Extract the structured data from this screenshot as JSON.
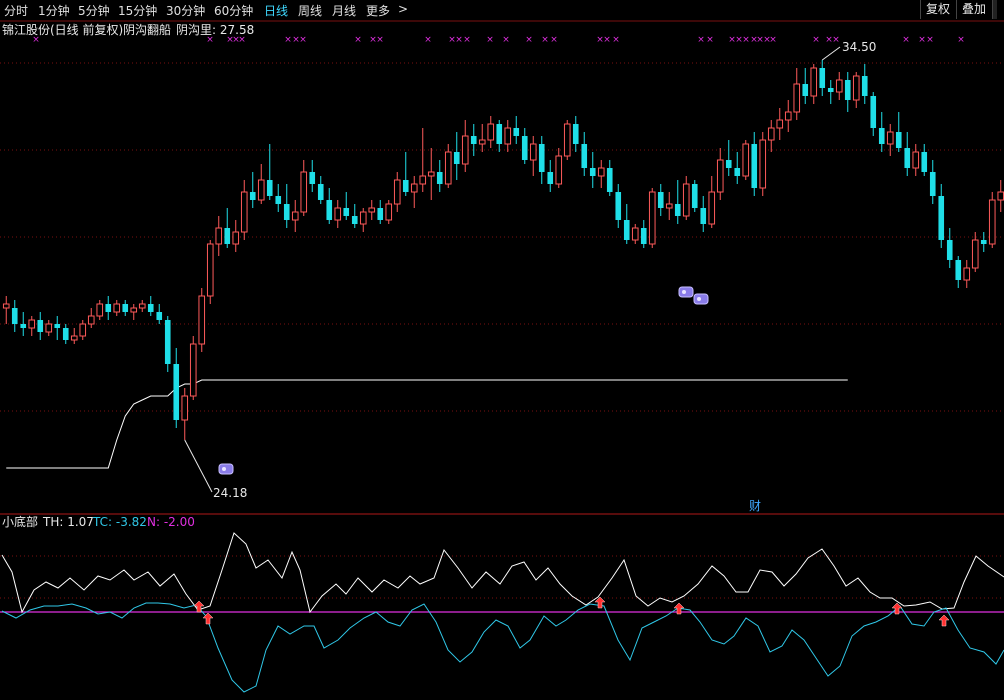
{
  "toolbar": {
    "periods": [
      "分时",
      "1分钟",
      "5分钟",
      "15分钟",
      "30分钟",
      "60分钟",
      "日线",
      "周线",
      "月线",
      "更多"
    ],
    "active_period": "日线",
    "more_arrow": ">",
    "restore_label": "复权",
    "overlay_label": "叠加"
  },
  "main_panel": {
    "title": "锦江股份(日线 前复权)",
    "indicator_name": "阴沟翻船",
    "indicator_value_label": "阴沟里: 27.58",
    "high_label": "34.50",
    "low_label": "24.18",
    "finance_marker": "财"
  },
  "sub_panel": {
    "name": "小底部",
    "th_label": "TH: 1.07",
    "tc_label": "TC: -3.82",
    "n_label": "N: -2.00"
  },
  "colors": {
    "up": "#ff5a5a",
    "down": "#1fdfe8",
    "line": "#ffffff",
    "magenta": "#e030e0",
    "cyan_line": "#30c8e8",
    "grid": "#7a1010"
  },
  "chart_data": {
    "type": "candlestick",
    "ylim": [
      23.5,
      35.0
    ],
    "candles": [
      [
        28.3,
        28.6,
        27.9,
        28.4
      ],
      [
        28.3,
        28.5,
        27.7,
        27.9
      ],
      [
        27.9,
        28.2,
        27.6,
        27.8
      ],
      [
        27.8,
        28.1,
        27.6,
        28.0
      ],
      [
        28.0,
        28.2,
        27.5,
        27.7
      ],
      [
        27.7,
        28.0,
        27.6,
        27.9
      ],
      [
        27.9,
        28.1,
        27.5,
        27.8
      ],
      [
        27.8,
        27.9,
        27.4,
        27.5
      ],
      [
        27.5,
        27.8,
        27.4,
        27.6
      ],
      [
        27.6,
        28.0,
        27.5,
        27.9
      ],
      [
        27.9,
        28.3,
        27.8,
        28.1
      ],
      [
        28.1,
        28.5,
        28.0,
        28.4
      ],
      [
        28.4,
        28.6,
        28.0,
        28.2
      ],
      [
        28.2,
        28.5,
        28.1,
        28.4
      ],
      [
        28.4,
        28.5,
        28.1,
        28.2
      ],
      [
        28.2,
        28.4,
        28.0,
        28.3
      ],
      [
        28.3,
        28.5,
        28.2,
        28.4
      ],
      [
        28.4,
        28.6,
        28.1,
        28.2
      ],
      [
        28.2,
        28.4,
        27.9,
        28.0
      ],
      [
        28.0,
        28.1,
        26.7,
        26.9
      ],
      [
        26.9,
        27.3,
        25.3,
        25.5
      ],
      [
        25.5,
        26.3,
        25.0,
        26.1
      ],
      [
        26.1,
        27.6,
        26.0,
        27.4
      ],
      [
        27.4,
        28.8,
        27.2,
        28.6
      ],
      [
        28.6,
        30.0,
        28.4,
        29.9
      ],
      [
        29.9,
        30.6,
        29.6,
        30.3
      ],
      [
        30.3,
        30.8,
        29.8,
        29.9
      ],
      [
        29.9,
        30.5,
        29.7,
        30.2
      ],
      [
        30.2,
        31.5,
        30.0,
        31.2
      ],
      [
        31.2,
        31.7,
        30.8,
        31.0
      ],
      [
        31.0,
        31.9,
        30.9,
        31.5
      ],
      [
        31.5,
        32.4,
        31.0,
        31.1
      ],
      [
        31.1,
        31.4,
        30.7,
        30.9
      ],
      [
        30.9,
        31.4,
        30.3,
        30.5
      ],
      [
        30.5,
        31.0,
        30.2,
        30.7
      ],
      [
        30.7,
        32.0,
        30.6,
        31.7
      ],
      [
        31.7,
        32.0,
        31.2,
        31.4
      ],
      [
        31.4,
        31.6,
        30.9,
        31.0
      ],
      [
        31.0,
        31.3,
        30.4,
        30.5
      ],
      [
        30.5,
        31.0,
        30.3,
        30.8
      ],
      [
        30.8,
        31.2,
        30.5,
        30.6
      ],
      [
        30.6,
        30.9,
        30.3,
        30.4
      ],
      [
        30.4,
        30.8,
        30.2,
        30.7
      ],
      [
        30.7,
        31.0,
        30.5,
        30.8
      ],
      [
        30.8,
        31.0,
        30.4,
        30.5
      ],
      [
        30.5,
        31.0,
        30.4,
        30.9
      ],
      [
        30.9,
        31.7,
        30.7,
        31.5
      ],
      [
        31.5,
        32.2,
        31.1,
        31.2
      ],
      [
        31.2,
        31.6,
        30.8,
        31.4
      ],
      [
        31.4,
        32.8,
        31.2,
        31.6
      ],
      [
        31.6,
        32.3,
        31.0,
        31.7
      ],
      [
        31.7,
        32.0,
        31.2,
        31.4
      ],
      [
        31.4,
        32.4,
        31.3,
        32.2
      ],
      [
        32.2,
        32.7,
        31.5,
        31.9
      ],
      [
        31.9,
        33.0,
        31.7,
        32.6
      ],
      [
        32.6,
        32.9,
        32.1,
        32.4
      ],
      [
        32.4,
        32.9,
        32.2,
        32.5
      ],
      [
        32.5,
        33.1,
        32.3,
        32.9
      ],
      [
        32.9,
        33.0,
        32.2,
        32.4
      ],
      [
        32.4,
        33.0,
        32.2,
        32.8
      ],
      [
        32.8,
        33.1,
        32.4,
        32.6
      ],
      [
        32.6,
        32.8,
        31.9,
        32.0
      ],
      [
        32.0,
        32.6,
        31.6,
        32.4
      ],
      [
        32.4,
        32.6,
        31.4,
        31.7
      ],
      [
        31.7,
        32.0,
        31.2,
        31.4
      ],
      [
        31.4,
        32.3,
        31.3,
        32.1
      ],
      [
        32.1,
        33.0,
        32.0,
        32.9
      ],
      [
        32.9,
        33.1,
        32.2,
        32.4
      ],
      [
        32.4,
        32.7,
        31.6,
        31.8
      ],
      [
        31.8,
        32.2,
        31.3,
        31.6
      ],
      [
        31.6,
        32.0,
        31.3,
        31.8
      ],
      [
        31.8,
        32.0,
        31.1,
        31.2
      ],
      [
        31.2,
        31.4,
        30.3,
        30.5
      ],
      [
        30.5,
        30.9,
        29.9,
        30.0
      ],
      [
        30.0,
        30.4,
        29.9,
        30.3
      ],
      [
        30.3,
        30.5,
        29.8,
        29.9
      ],
      [
        29.9,
        31.3,
        29.8,
        31.2
      ],
      [
        31.2,
        31.4,
        30.6,
        30.8
      ],
      [
        30.8,
        31.2,
        30.5,
        30.9
      ],
      [
        30.9,
        31.5,
        30.4,
        30.6
      ],
      [
        30.6,
        31.6,
        30.5,
        31.4
      ],
      [
        31.4,
        31.5,
        30.7,
        30.8
      ],
      [
        30.8,
        31.1,
        30.2,
        30.4
      ],
      [
        30.4,
        31.6,
        30.3,
        31.2
      ],
      [
        31.2,
        32.3,
        31.0,
        32.0
      ],
      [
        32.0,
        32.5,
        31.6,
        31.8
      ],
      [
        31.8,
        32.2,
        31.4,
        31.6
      ],
      [
        31.6,
        32.5,
        31.5,
        32.4
      ],
      [
        32.4,
        32.7,
        31.1,
        31.3
      ],
      [
        31.3,
        32.7,
        31.1,
        32.5
      ],
      [
        32.5,
        33.0,
        32.2,
        32.8
      ],
      [
        32.8,
        33.3,
        32.5,
        33.0
      ],
      [
        33.0,
        33.5,
        32.7,
        33.2
      ],
      [
        33.2,
        34.3,
        33.0,
        33.9
      ],
      [
        33.9,
        34.3,
        33.4,
        33.6
      ],
      [
        33.6,
        34.4,
        33.4,
        34.3
      ],
      [
        34.3,
        34.5,
        33.6,
        33.8
      ],
      [
        33.8,
        34.0,
        33.4,
        33.7
      ],
      [
        33.7,
        34.2,
        33.5,
        34.0
      ],
      [
        34.0,
        34.2,
        33.2,
        33.5
      ],
      [
        33.5,
        34.2,
        33.3,
        34.1
      ],
      [
        34.1,
        34.4,
        33.4,
        33.6
      ],
      [
        33.6,
        33.7,
        32.6,
        32.8
      ],
      [
        32.8,
        33.2,
        32.2,
        32.4
      ],
      [
        32.4,
        32.9,
        32.1,
        32.7
      ],
      [
        32.7,
        33.2,
        32.2,
        32.3
      ],
      [
        32.3,
        32.7,
        31.6,
        31.8
      ],
      [
        31.8,
        32.4,
        31.6,
        32.2
      ],
      [
        32.2,
        32.4,
        31.6,
        31.7
      ],
      [
        31.7,
        32.0,
        30.9,
        31.1
      ],
      [
        31.1,
        31.4,
        29.8,
        30.0
      ],
      [
        30.0,
        30.3,
        29.3,
        29.5
      ],
      [
        29.5,
        29.6,
        28.8,
        29.0
      ],
      [
        29.0,
        29.5,
        28.8,
        29.3
      ],
      [
        29.3,
        30.2,
        29.2,
        30.0
      ],
      [
        30.0,
        30.2,
        29.7,
        29.9
      ],
      [
        29.9,
        31.2,
        29.8,
        31.0
      ],
      [
        31.0,
        31.5,
        30.7,
        31.2
      ],
      [
        31.2,
        31.6,
        30.8,
        31.1
      ]
    ],
    "support_line": [
      24.3,
      24.3,
      24.3,
      24.3,
      24.3,
      24.3,
      24.3,
      24.3,
      24.3,
      24.3,
      24.3,
      24.3,
      24.3,
      25.0,
      25.6,
      25.9,
      26.0,
      26.1,
      26.1,
      26.1,
      26.3,
      26.4,
      26.4,
      26.5,
      26.5,
      26.5,
      26.5,
      26.5,
      26.5,
      26.5,
      26.5,
      26.5,
      26.5,
      26.5,
      26.5,
      26.5,
      26.5,
      26.5,
      26.5,
      26.5,
      26.5,
      26.5,
      26.5,
      26.5,
      26.5,
      26.5,
      26.5,
      26.5,
      26.5,
      26.5,
      26.5,
      26.5,
      26.5,
      26.5,
      26.5,
      26.5,
      26.5,
      26.5,
      26.5,
      26.5,
      26.5,
      26.5,
      26.5,
      26.5,
      26.5,
      26.5,
      26.5,
      26.5,
      26.5,
      26.5,
      26.5,
      26.5,
      26.5,
      26.5,
      26.5,
      26.5,
      26.5,
      26.5,
      26.5,
      26.5,
      26.5,
      26.5,
      26.5,
      26.5,
      26.5,
      26.5,
      26.5,
      26.5,
      26.5,
      26.5,
      26.5,
      26.5,
      26.5,
      26.5,
      26.5,
      26.5,
      26.5,
      26.5,
      26.5,
      26.5
    ]
  }
}
